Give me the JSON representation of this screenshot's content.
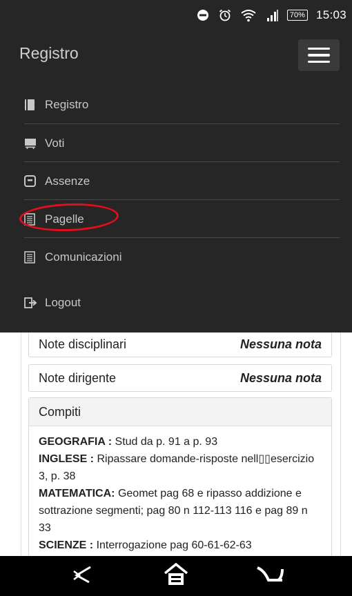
{
  "status_bar": {
    "icons": [
      "do-not-disturb-icon",
      "alarm-icon",
      "wifi-icon",
      "signal-icon"
    ],
    "battery": "70%",
    "time": "15:03"
  },
  "navbar": {
    "brand": "Registro",
    "menu_button_icon": "hamburger-icon"
  },
  "menu": {
    "items": [
      {
        "label": "Registro",
        "icon": "book-icon"
      },
      {
        "label": "Voti",
        "icon": "monitor-icon"
      },
      {
        "label": "Assenze",
        "icon": "square-icon"
      },
      {
        "label": "Pagelle",
        "icon": "report-icon",
        "highlighted": true
      },
      {
        "label": "Comunicazioni",
        "icon": "list-icon"
      },
      {
        "label": "Logout",
        "icon": "logout-icon"
      }
    ],
    "highlight_color": "#e10f1d"
  },
  "content": {
    "note_disciplinari": {
      "label": "Note disciplinari",
      "value": "Nessuna nota"
    },
    "note_dirigente": {
      "label": "Note dirigente",
      "value": "Nessuna nota"
    },
    "compiti": {
      "title": "Compiti",
      "entries": [
        {
          "subject": "GEOGRAFIA :",
          "text": " Stud da p. 91 a p. 93"
        },
        {
          "subject": "INGLESE :",
          "text": " Ripassare domande-risposte nell▯▯esercizio 3, p. 38"
        },
        {
          "subject": "MATEMATICA:",
          "text": " Geomet pag 68 e ripasso addizione e sottrazione segmenti; pag 80 n 112-113 116 e pag 89 n 33"
        },
        {
          "subject": "SCIENZE :",
          "text": " Interrogazione pag 60-61-62-63"
        }
      ]
    }
  },
  "bottom_nav": {
    "icons": [
      "back-icon",
      "home-icon",
      "recent-apps-icon"
    ]
  }
}
